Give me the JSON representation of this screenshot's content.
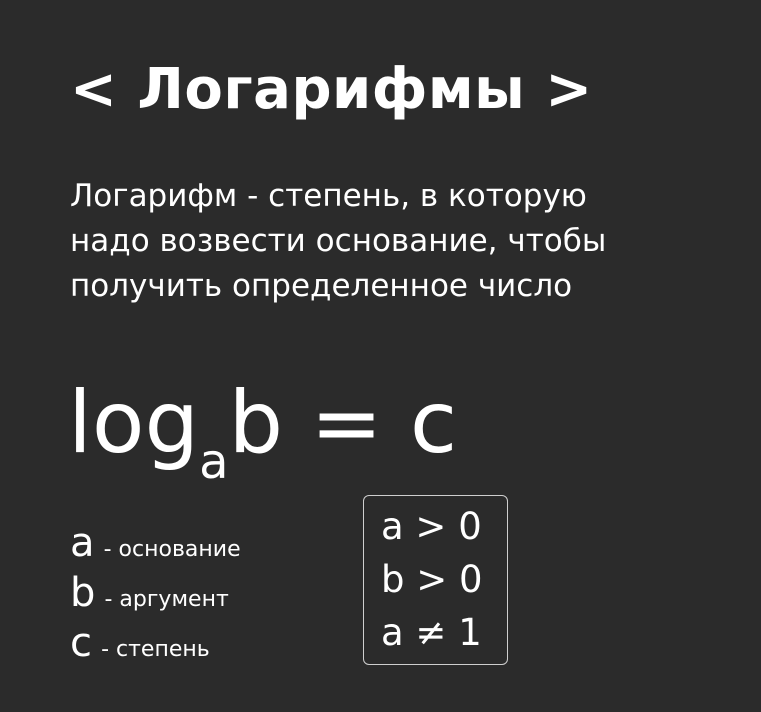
{
  "title": "< Логарифмы >",
  "definition": {
    "lines": [
      "Логарифм - степень, в которую",
      "надо возвести основание, чтобы",
      "получить определенное число"
    ]
  },
  "formula": {
    "log": "log",
    "base": "a",
    "rest": "b = c"
  },
  "legend": [
    {
      "var": "a",
      "desc": "- основание"
    },
    {
      "var": "b",
      "desc": "- аргумент"
    },
    {
      "var": "c",
      "desc": "- степень"
    }
  ],
  "conditions": [
    "a > 0",
    "b > 0",
    "a ≠ 1"
  ],
  "colors": {
    "background": "#2b2b2b",
    "text": "#ffffff",
    "border": "#cfcfcf"
  }
}
